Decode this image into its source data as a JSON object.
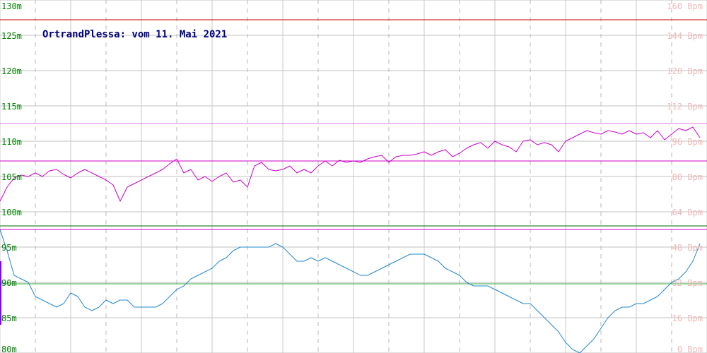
{
  "chart_data": {
    "type": "line",
    "title": "OrtrandPlessa: vom 11. Mai 2021",
    "grid": true,
    "x_range": [
      0,
      1000
    ],
    "left_axis": {
      "ticks": [
        "130m",
        "125m",
        "120m",
        "115m",
        "110m",
        "105m",
        "100m",
        "95m",
        "90m",
        "85m",
        "80m"
      ],
      "ylim": [
        80,
        130
      ]
    },
    "right_axis": {
      "ticks": [
        "160 Bpm",
        "144 Bpm",
        "128 Bpm",
        "112 Bpm",
        "96 Bpm",
        "80 Bpm",
        "64 Bpm",
        "48 Bpm",
        "32 Bpm",
        "16 Bpm",
        "0 Bpm"
      ],
      "ylim": [
        0,
        160
      ]
    },
    "reference_lines": [
      {
        "name": "upper-red",
        "axis": "left",
        "value": 127.2,
        "color": "#cc0000"
      },
      {
        "name": "pulse-max",
        "axis": "left",
        "value": 112.5,
        "color": "#dd77dd"
      },
      {
        "name": "pulse-mean",
        "axis": "left",
        "value": 107.2,
        "color": "#cc00cc"
      },
      {
        "name": "level-max",
        "axis": "left",
        "value": 98.0,
        "color": "#006600"
      },
      {
        "name": "level-mark",
        "axis": "left",
        "value": 97.5,
        "color": "#cc00cc"
      },
      {
        "name": "level-min",
        "axis": "left",
        "value": 89.8,
        "color": "#33aa33"
      }
    ],
    "series": [
      {
        "id": "pulse",
        "color": "#cc00cc",
        "axis": "left",
        "x": [
          0,
          10,
          20,
          30,
          40,
          50,
          60,
          70,
          80,
          90,
          100,
          110,
          120,
          130,
          140,
          150,
          160,
          170,
          180,
          190,
          200,
          210,
          220,
          230,
          240,
          250,
          260,
          270,
          280,
          290,
          300,
          310,
          320,
          330,
          340,
          350,
          360,
          370,
          380,
          390,
          400,
          410,
          420,
          430,
          440,
          450,
          460,
          470,
          480,
          490,
          500,
          510,
          520,
          530,
          540,
          550,
          560,
          570,
          580,
          590,
          600,
          610,
          620,
          630,
          640,
          650,
          660,
          670,
          680,
          690,
          700,
          710,
          720,
          730,
          740,
          750,
          760,
          770,
          780,
          790,
          800,
          810,
          820,
          830,
          840,
          850,
          860,
          870,
          880,
          890,
          900,
          910,
          920,
          930,
          940,
          950,
          960,
          970,
          980,
          990
        ],
        "y": [
          101.5,
          103.5,
          104.8,
          105.2,
          105.0,
          105.5,
          105.0,
          105.8,
          106.0,
          105.3,
          104.8,
          105.5,
          106.0,
          105.5,
          105.0,
          104.5,
          103.8,
          101.5,
          103.5,
          104.0,
          104.5,
          105.0,
          105.5,
          106.0,
          106.8,
          107.5,
          105.5,
          106.0,
          104.5,
          105.0,
          104.3,
          105.0,
          105.5,
          104.2,
          104.5,
          103.5,
          106.5,
          107.0,
          106.0,
          105.8,
          106.0,
          106.5,
          105.5,
          106.0,
          105.5,
          106.5,
          107.2,
          106.5,
          107.3,
          107.0,
          107.2,
          107.0,
          107.5,
          107.8,
          108.0,
          107.0,
          107.8,
          108.0,
          108.0,
          108.2,
          108.5,
          108.0,
          108.5,
          108.8,
          107.8,
          108.3,
          109.0,
          109.5,
          109.8,
          109.0,
          110.0,
          109.5,
          109.2,
          108.5,
          110.0,
          110.2,
          109.5,
          109.8,
          109.5,
          108.5,
          110.0,
          110.5,
          111.0,
          111.5,
          111.2,
          111.0,
          111.5,
          111.3,
          111.0,
          111.5,
          111.0,
          111.2,
          110.5,
          111.5,
          110.2,
          111.0,
          111.8,
          111.5,
          112.0,
          110.5
        ]
      },
      {
        "id": "level",
        "color": "#2288cc",
        "axis": "left",
        "x": [
          0,
          10,
          20,
          30,
          40,
          50,
          60,
          70,
          80,
          90,
          100,
          110,
          120,
          130,
          140,
          150,
          160,
          170,
          180,
          190,
          200,
          210,
          220,
          230,
          240,
          250,
          260,
          270,
          280,
          290,
          300,
          310,
          320,
          330,
          340,
          350,
          360,
          370,
          380,
          390,
          400,
          410,
          420,
          430,
          440,
          450,
          460,
          470,
          480,
          490,
          500,
          510,
          520,
          530,
          540,
          550,
          560,
          570,
          580,
          590,
          600,
          610,
          620,
          630,
          640,
          650,
          660,
          670,
          680,
          690,
          700,
          710,
          720,
          730,
          740,
          750,
          760,
          770,
          780,
          790,
          800,
          810,
          820,
          830,
          840,
          850,
          860,
          870,
          880,
          890,
          900,
          910,
          920,
          930,
          940,
          950,
          960,
          970,
          980,
          990
        ],
        "y": [
          97.5,
          94.5,
          91.0,
          90.5,
          90.0,
          88.0,
          87.5,
          87.0,
          86.5,
          87.0,
          88.5,
          88.0,
          86.5,
          86.0,
          86.5,
          87.5,
          87.0,
          87.5,
          87.5,
          86.5,
          86.5,
          86.5,
          86.5,
          87.0,
          88.0,
          89.0,
          89.5,
          90.5,
          91.0,
          91.5,
          92.0,
          93.0,
          93.5,
          94.5,
          95.0,
          95.0,
          95.0,
          95.0,
          95.0,
          95.5,
          95.0,
          94.0,
          93.0,
          93.0,
          93.5,
          93.0,
          93.5,
          93.0,
          92.5,
          92.0,
          91.5,
          91.0,
          91.0,
          91.5,
          92.0,
          92.5,
          93.0,
          93.5,
          94.0,
          94.0,
          94.0,
          93.5,
          93.0,
          92.0,
          91.5,
          91.0,
          90.0,
          89.5,
          89.5,
          89.5,
          89.0,
          88.5,
          88.0,
          87.5,
          87.0,
          87.0,
          86.0,
          85.0,
          84.0,
          83.0,
          81.5,
          80.5,
          80.0,
          81.0,
          82.0,
          83.5,
          85.0,
          86.0,
          86.5,
          86.5,
          87.0,
          87.0,
          87.5,
          88.0,
          89.0,
          90.0,
          90.5,
          91.5,
          93.0,
          95.5
        ]
      },
      {
        "id": "left-edge-marker",
        "color": "#8800ff",
        "axis": "left",
        "x": [
          1,
          1
        ],
        "y": [
          93.0,
          84.0
        ]
      }
    ]
  }
}
